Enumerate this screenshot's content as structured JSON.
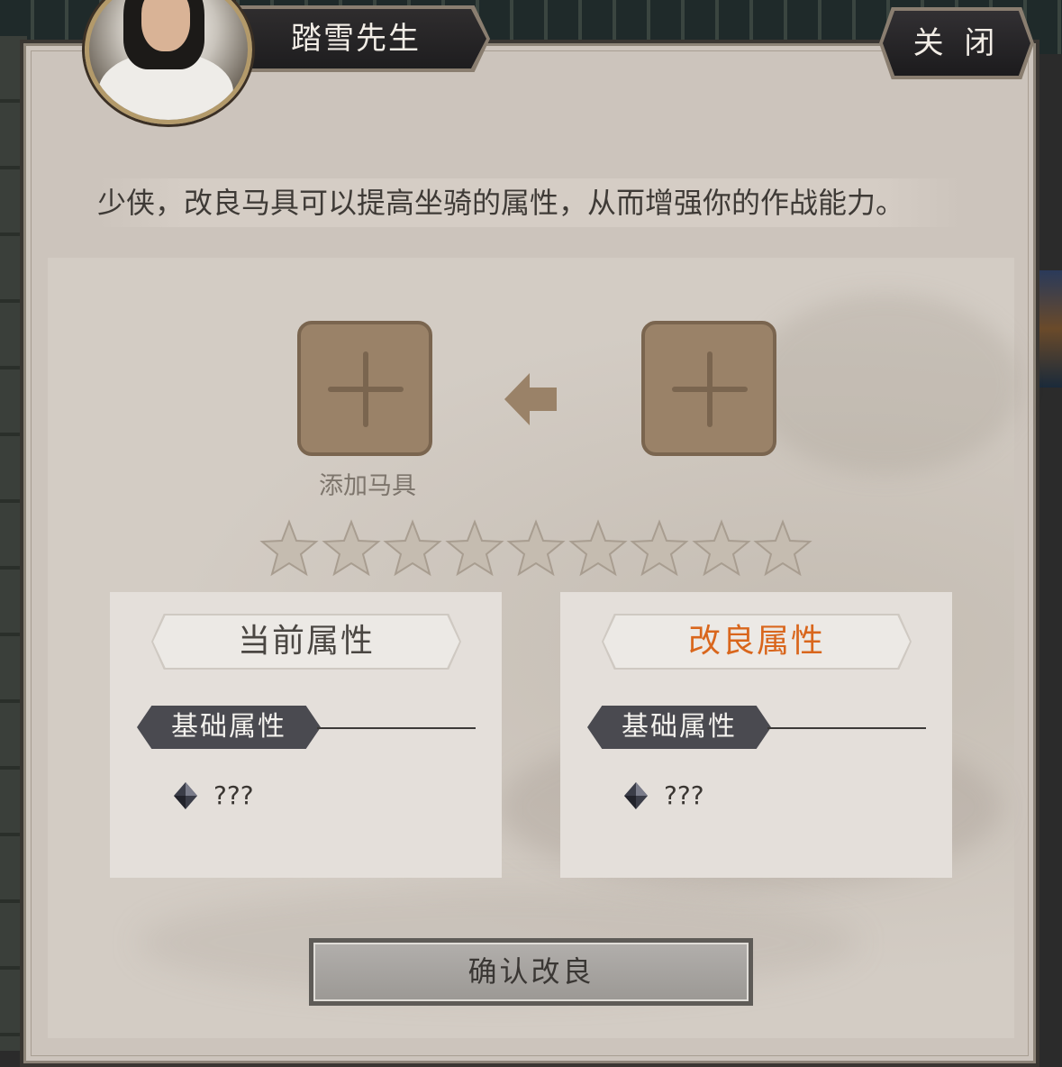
{
  "dialog": {
    "npc_name": "踏雪先生",
    "close_label": "关 闭",
    "intro_text": "少侠，改良马具可以提高坐骑的属性，从而增强你的作战能力。"
  },
  "refine": {
    "slot_label": "添加马具",
    "stars_total": 9,
    "stars_filled": 0
  },
  "current_card": {
    "title": "当前属性",
    "section": "基础属性",
    "value": "???"
  },
  "refined_card": {
    "title": "改良属性",
    "section": "基础属性",
    "value": "???"
  },
  "confirm_label": "确认改良",
  "colors": {
    "panel": "#ccc4bc",
    "slot": "#9a8268",
    "star": "#c5bcb0",
    "refined_title": "#d9661c",
    "current_title": "#4a4642"
  }
}
